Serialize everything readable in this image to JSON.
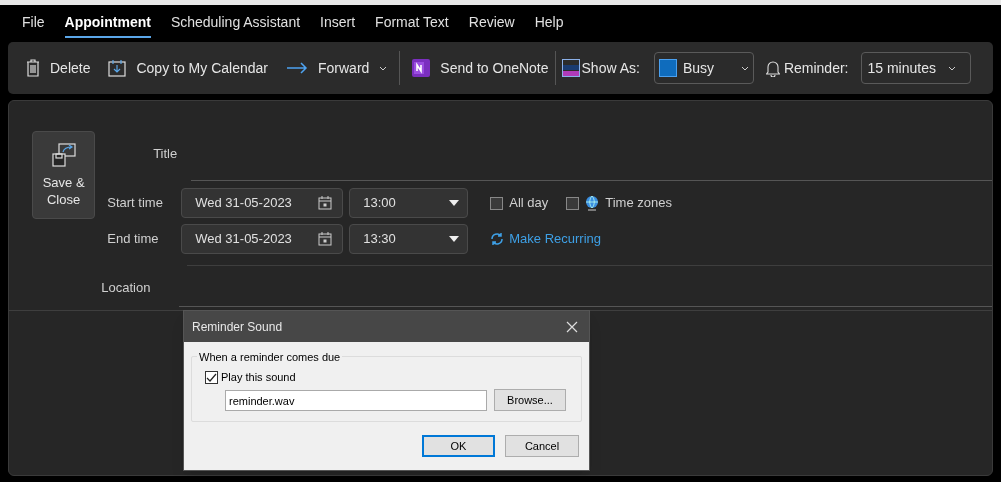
{
  "menu_tabs": [
    {
      "label": "File",
      "selected": false
    },
    {
      "label": "Appointment",
      "selected": true
    },
    {
      "label": "Scheduling Assistant",
      "selected": false
    },
    {
      "label": "Insert",
      "selected": false
    },
    {
      "label": "Format Text",
      "selected": false
    },
    {
      "label": "Review",
      "selected": false
    },
    {
      "label": "Help",
      "selected": false
    }
  ],
  "ribbon": {
    "delete": "Delete",
    "copy": "Copy to My Calendar",
    "forward": "Forward",
    "onenote": "Send to OneNote",
    "show_as_label": "Show As:",
    "show_as_value": "Busy",
    "reminder_label": "Reminder:",
    "reminder_value": "15 minutes"
  },
  "form": {
    "save_close": "Save & Close",
    "title_label": "Title",
    "start_label": "Start time",
    "end_label": "End time",
    "location_label": "Location",
    "start_date": "Wed 31-05-2023",
    "start_time": "13:00",
    "end_date": "Wed 31-05-2023",
    "end_time": "13:30",
    "all_day": {
      "label": "All day",
      "checked": false
    },
    "time_zones": {
      "label": "Time zones",
      "checked": false
    },
    "make_recurring": "Make Recurring"
  },
  "dialog": {
    "title": "Reminder Sound",
    "group_label": "When a reminder comes due",
    "play_sound": {
      "label": "Play this sound",
      "checked": true
    },
    "file": "reminder.wav",
    "browse": "Browse...",
    "ok": "OK",
    "cancel": "Cancel"
  }
}
